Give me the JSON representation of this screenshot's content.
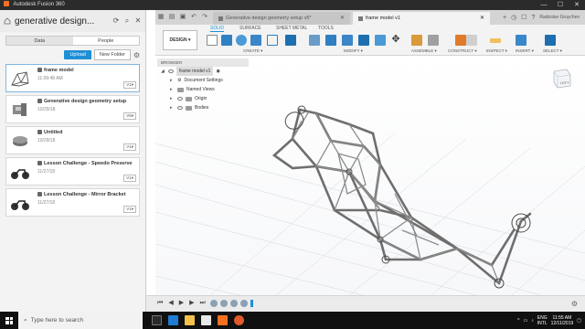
{
  "window": {
    "title": "Autodesk Fusion 360",
    "controls": [
      "—",
      "☐",
      "✕"
    ]
  },
  "data_panel": {
    "project_title": "generative design...",
    "tabs": [
      {
        "label": "Data"
      },
      {
        "label": "People"
      }
    ],
    "upload_label": "Upload",
    "new_folder_label": "New Folder",
    "files": [
      {
        "name": "frame model",
        "date": "11:09:48 AM",
        "version": "V1▾"
      },
      {
        "name": "Generative design geometry setup",
        "date": "10/29/18",
        "version": "V5▾"
      },
      {
        "name": "Untitled",
        "date": "10/29/18",
        "version": "V1▾"
      },
      {
        "name": "Lesson Challenge - Speedo Preserve",
        "date": "11/27/18",
        "version": "V1▾"
      },
      {
        "name": "Lesson Challenge - Mirror Bracket",
        "date": "11/27/18",
        "version": "V1▾"
      }
    ]
  },
  "doc_tabs": [
    {
      "label": "Generative design geometry setup v5*",
      "active": false
    },
    {
      "label": "frame model v1",
      "active": true
    }
  ],
  "user_name": "Radoslav Gruychev",
  "toolbar": {
    "workspace": "DESIGN ▾",
    "tabs": [
      "SOLID",
      "SURFACE",
      "SHEET METAL",
      "TOOLS"
    ],
    "groups": [
      "CREATE ▾",
      "MODIFY ▾",
      "ASSEMBLE ▾",
      "CONSTRUCT ▾",
      "INSPECT ▾",
      "INSERT ▾",
      "SELECT ▾"
    ]
  },
  "browser": {
    "header": "BROWSER",
    "root": "frame model v1",
    "items": [
      {
        "label": "Document Settings"
      },
      {
        "label": "Named Views"
      },
      {
        "label": "Origin"
      },
      {
        "label": "Bodies"
      }
    ]
  },
  "viewcube_label": "LEFT",
  "taskbar": {
    "search_placeholder": "Type here to search",
    "lang": "ENG",
    "region": "INTL",
    "time": "11:55 AM",
    "date": "12/11/2019"
  },
  "colors": {
    "accent": "#1e8fd6",
    "chrome": "#2b2b2b",
    "taskbar": "#101010"
  }
}
